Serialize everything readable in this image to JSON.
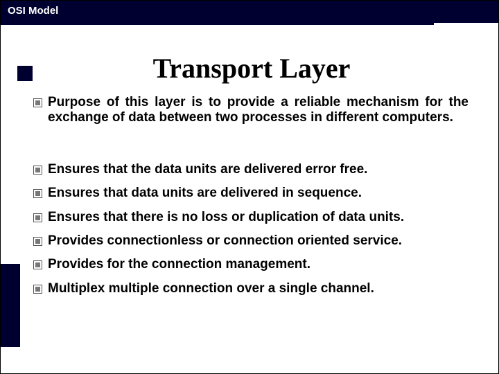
{
  "header": {
    "label": "OSI Model"
  },
  "title": "Transport Layer",
  "bullets": [
    {
      "text": "Purpose of this layer is to provide a reliable mechanism for the exchange of data between two processes in different computers.",
      "big_gap": true
    },
    {
      "text": "Ensures that the data units are delivered error free."
    },
    {
      "text": "Ensures that data units are delivered in sequence."
    },
    {
      "text": "Ensures that there is no loss or duplication of data units."
    },
    {
      "text": "Provides connectionless or connection oriented service."
    },
    {
      "text": "Provides for the connection management."
    },
    {
      "text": "Multiplex  multiple connection over a single channel."
    }
  ]
}
